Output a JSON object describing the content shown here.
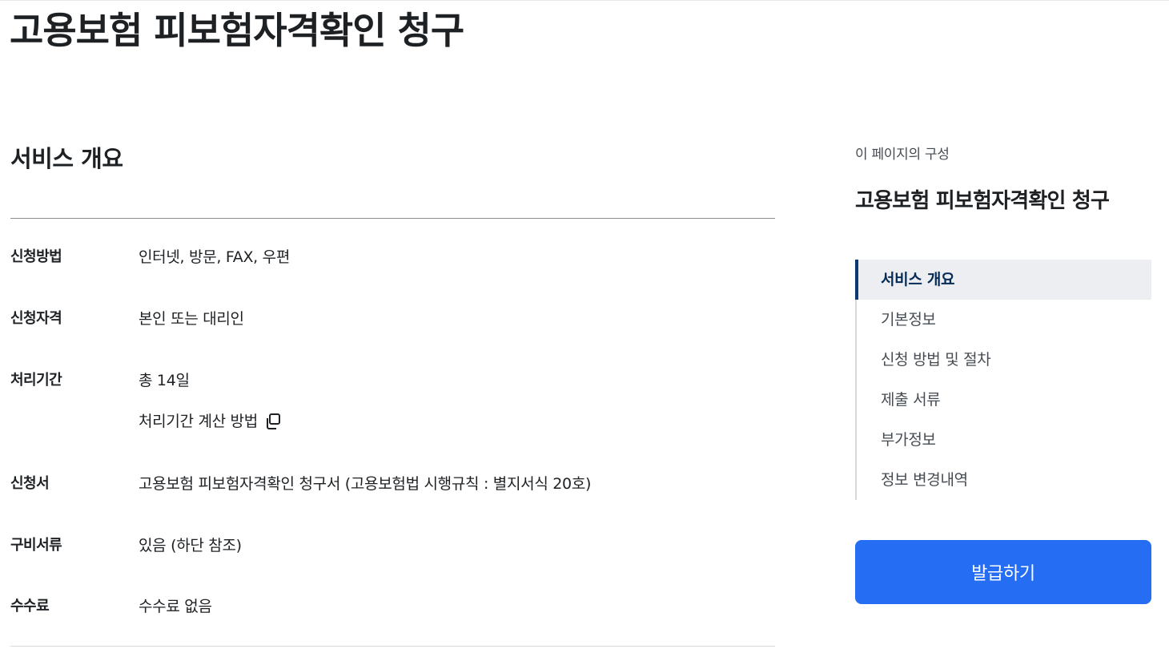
{
  "page": {
    "title": "고용보험 피보험자격확인 청구"
  },
  "overview": {
    "section_title": "서비스 개요",
    "rows": [
      {
        "label": "신청방법",
        "value": "인터넷, 방문, FAX, 우편"
      },
      {
        "label": "신청자격",
        "value": "본인 또는 대리인"
      },
      {
        "label": "처리기간",
        "value": "총 14일",
        "link": "처리기간 계산 방법",
        "link_icon": "copy-icon"
      },
      {
        "label": "신청서",
        "value": "고용보험 피보험자격확인 청구서 (고용보험법 시행규칙 : 별지서식 20호)"
      },
      {
        "label": "구비서류",
        "value": "있음 (하단 참조)"
      },
      {
        "label": "수수료",
        "value": "수수료 없음"
      }
    ]
  },
  "aside": {
    "caption": "이 페이지의 구성",
    "title": "고용보험 피보험자격확인 청구",
    "toc": [
      {
        "label": "서비스 개요",
        "active": true
      },
      {
        "label": "기본정보"
      },
      {
        "label": "신청 방법 및 절차"
      },
      {
        "label": "제출 서류"
      },
      {
        "label": "부가정보"
      },
      {
        "label": "정보 변경내역"
      }
    ],
    "issue_button": "발급하기"
  },
  "colors": {
    "primary_button": "#256ef4",
    "toc_active_bg": "#eceef2",
    "toc_active_bar": "#0b3a73",
    "text": "#1e2124"
  }
}
